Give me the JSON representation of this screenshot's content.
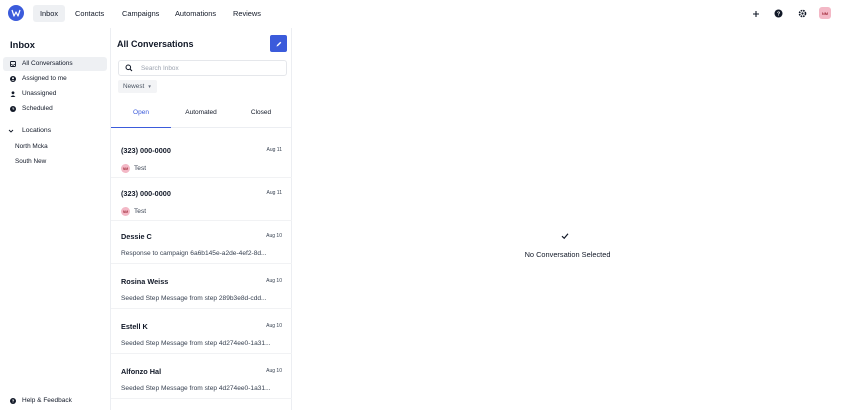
{
  "topnav": {
    "logo_icon": "brand-logo-icon",
    "items": [
      {
        "label": "Inbox",
        "active": true
      },
      {
        "label": "Contacts",
        "active": false
      },
      {
        "label": "Campaigns",
        "active": false
      },
      {
        "label": "Automations",
        "active": false
      },
      {
        "label": "Reviews",
        "active": false
      }
    ],
    "icons": [
      "plus-icon",
      "help-icon",
      "settings-icon"
    ],
    "avatar_initials": "NM"
  },
  "sidebar": {
    "title": "Inbox",
    "items": [
      {
        "label": "All Conversations",
        "icon": "inbox-icon",
        "active": true
      },
      {
        "label": "Assigned to me",
        "icon": "user-circle-icon",
        "active": false
      },
      {
        "label": "Unassigned",
        "icon": "user-icon",
        "active": false
      },
      {
        "label": "Scheduled",
        "icon": "clock-icon",
        "active": false
      }
    ],
    "locations": {
      "label": "Locations",
      "items": [
        "North Mcka",
        "South New"
      ]
    },
    "help_label": "Help & Feedback"
  },
  "conversations": {
    "title": "All Conversations",
    "search_placeholder": "Search Inbox",
    "sort_label": "Newest",
    "tabs": [
      {
        "label": "Open",
        "active": true
      },
      {
        "label": "Automated",
        "active": false
      },
      {
        "label": "Closed",
        "active": false
      }
    ],
    "items": [
      {
        "name": "(323) 000-0000",
        "date": "Aug 11",
        "avatar": "NM",
        "preview": "Test"
      },
      {
        "name": "(323) 000-0000",
        "date": "Aug 11",
        "avatar": "NM",
        "preview": "Test"
      },
      {
        "name": "Dessie C",
        "date": "Aug 10",
        "avatar": "",
        "preview": "Response to campaign 6a6b145e-a2de-4ef2-8d..."
      },
      {
        "name": "Rosina Weiss",
        "date": "Aug 10",
        "avatar": "",
        "preview": "Seeded Step Message from step 289b3e8d-cdd..."
      },
      {
        "name": "Estell K",
        "date": "Aug 10",
        "avatar": "",
        "preview": "Seeded Step Message from step 4d274ee0-1a31..."
      },
      {
        "name": "Alfonzo Hal",
        "date": "Aug 10",
        "avatar": "",
        "preview": "Seeded Step Message from step 4d274ee0-1a31..."
      }
    ]
  },
  "detail": {
    "empty_label": "No Conversation Selected"
  },
  "colors": {
    "accent": "#3b5bdb",
    "avatar_bg": "#f3b8c6"
  }
}
